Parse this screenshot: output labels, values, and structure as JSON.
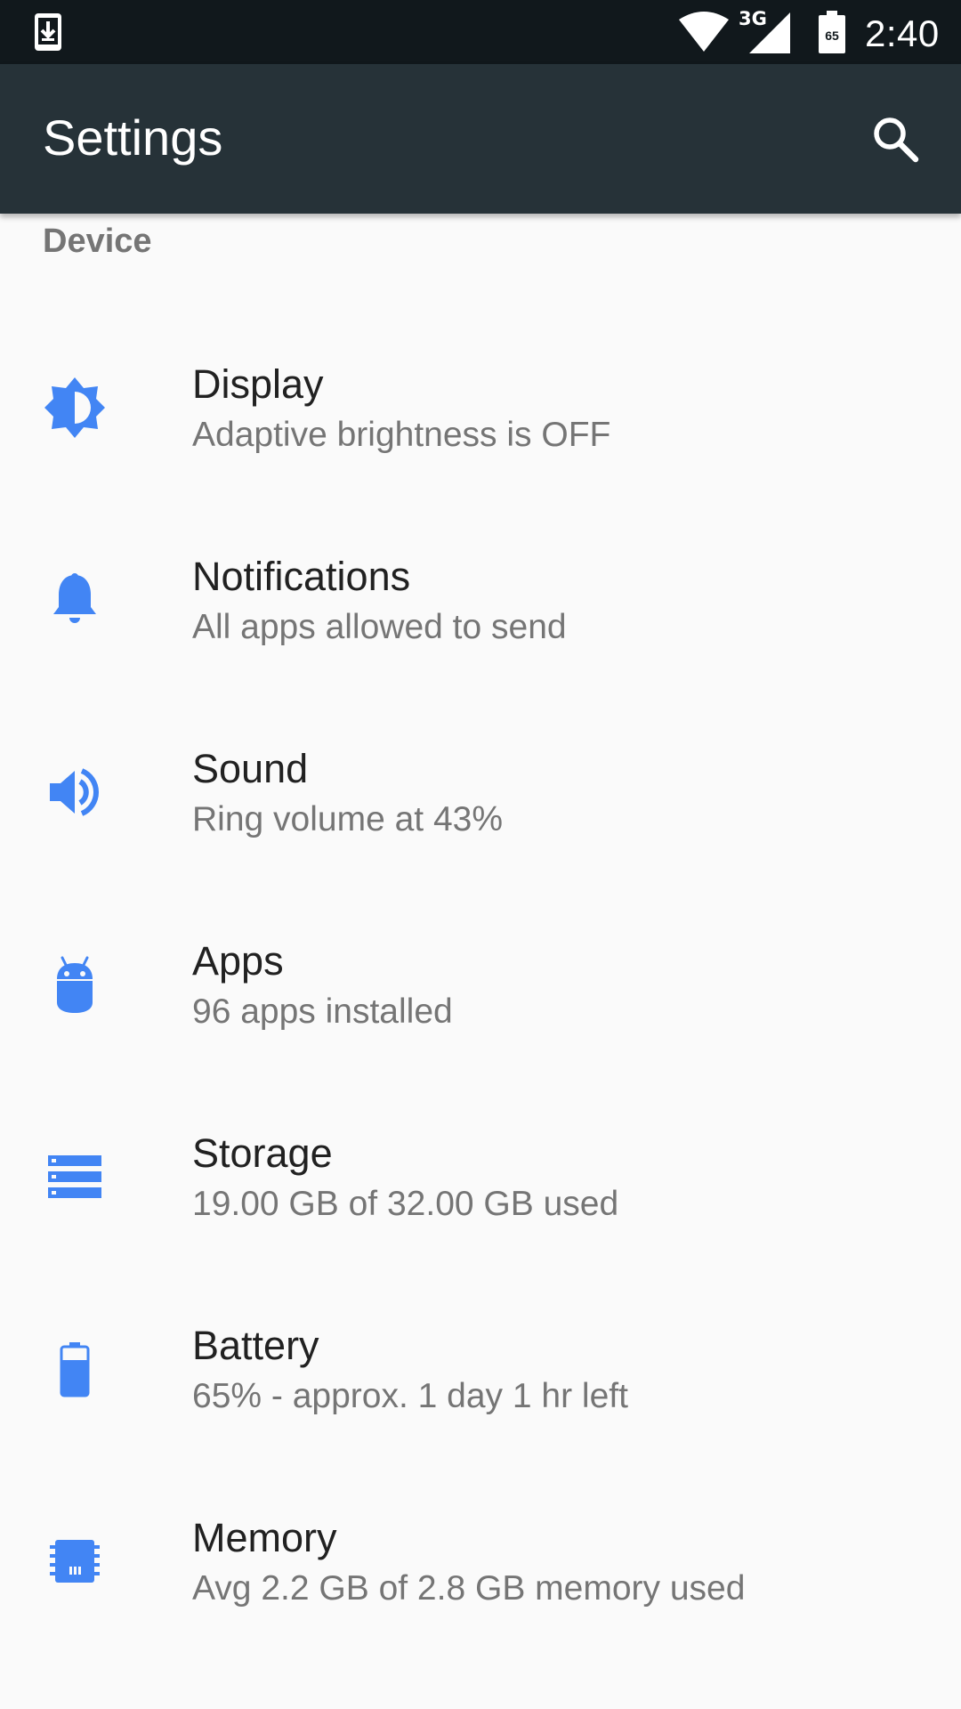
{
  "status_bar": {
    "time": "2:40",
    "network_label": "3G",
    "battery_level": "65",
    "icons": [
      "download-icon",
      "wifi-icon",
      "cell-signal-icon",
      "battery-icon"
    ]
  },
  "app_bar": {
    "title": "Settings",
    "search_icon": "search-icon",
    "background_color": "#263238"
  },
  "section": {
    "header": "Device"
  },
  "accent_color": "#4285f4",
  "items": [
    {
      "icon": "brightness-icon",
      "title": "Display",
      "summary": "Adaptive brightness is OFF"
    },
    {
      "icon": "bell-icon",
      "title": "Notifications",
      "summary": "All apps allowed to send"
    },
    {
      "icon": "volume-icon",
      "title": "Sound",
      "summary": "Ring volume at 43%"
    },
    {
      "icon": "android-icon",
      "title": "Apps",
      "summary": "96 apps installed"
    },
    {
      "icon": "storage-icon",
      "title": "Storage",
      "summary": "19.00 GB of 32.00 GB used"
    },
    {
      "icon": "battery-icon",
      "title": "Battery",
      "summary": "65% - approx. 1 day 1 hr left"
    },
    {
      "icon": "memory-icon",
      "title": "Memory",
      "summary": "Avg 2.2 GB of 2.8 GB memory used"
    }
  ]
}
